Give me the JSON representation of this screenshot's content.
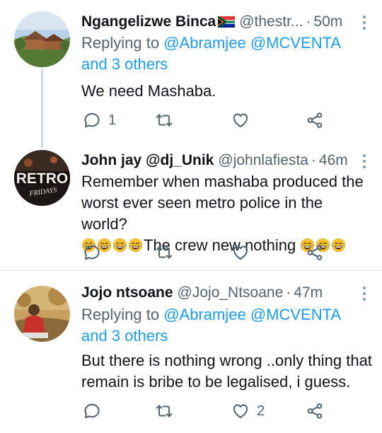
{
  "tweets": [
    {
      "name": "Ngangelizwe Binca",
      "flag": "South Africa flag",
      "handle": "@thestr...",
      "dot": "·",
      "time": "50m",
      "replying_prefix": "Replying to ",
      "reply_to_1": "@Abramjee",
      "reply_to_2": "@MCVENTA",
      "reply_others": "and 3 others",
      "text": "We need Mashaba.",
      "reply_count": "1",
      "retweet_count": "",
      "like_count": ""
    },
    {
      "name": "John jay @dj_Unik",
      "handle": "@johnlafiesta",
      "dot": "·",
      "time": "46m",
      "avatar_text": "RETRO",
      "avatar_subtext": "FRIDAYS",
      "text_line1": "Remember when mashaba produced the",
      "text_line2": "worst ever seen metro police in the world?",
      "text_line3": "The crew new nothing",
      "emoji": "face-with-tears-of-joy",
      "reply_count": "",
      "retweet_count": "",
      "like_count": ""
    },
    {
      "name": "Jojo ntsoane",
      "handle": "@Jojo_Ntsoane",
      "dot": "·",
      "time": "47m",
      "replying_prefix": "Replying to ",
      "reply_to_1": "@Abramjee",
      "reply_to_2": "@MCVENTA",
      "reply_others": "and 3 others",
      "text": "But there is nothing wrong ..only thing that remain is bribe to be legalised, i guess.",
      "reply_count": "",
      "retweet_count": "",
      "like_count": "2"
    }
  ],
  "colors": {
    "link": "#1d9bf0",
    "secondary_text": "#536471",
    "icon": "#536471",
    "divider": "#e6ecf0",
    "thread_line": "#cfd9de"
  },
  "icons": [
    "reply-icon",
    "retweet-icon",
    "like-icon",
    "share-icon",
    "more-icon"
  ]
}
